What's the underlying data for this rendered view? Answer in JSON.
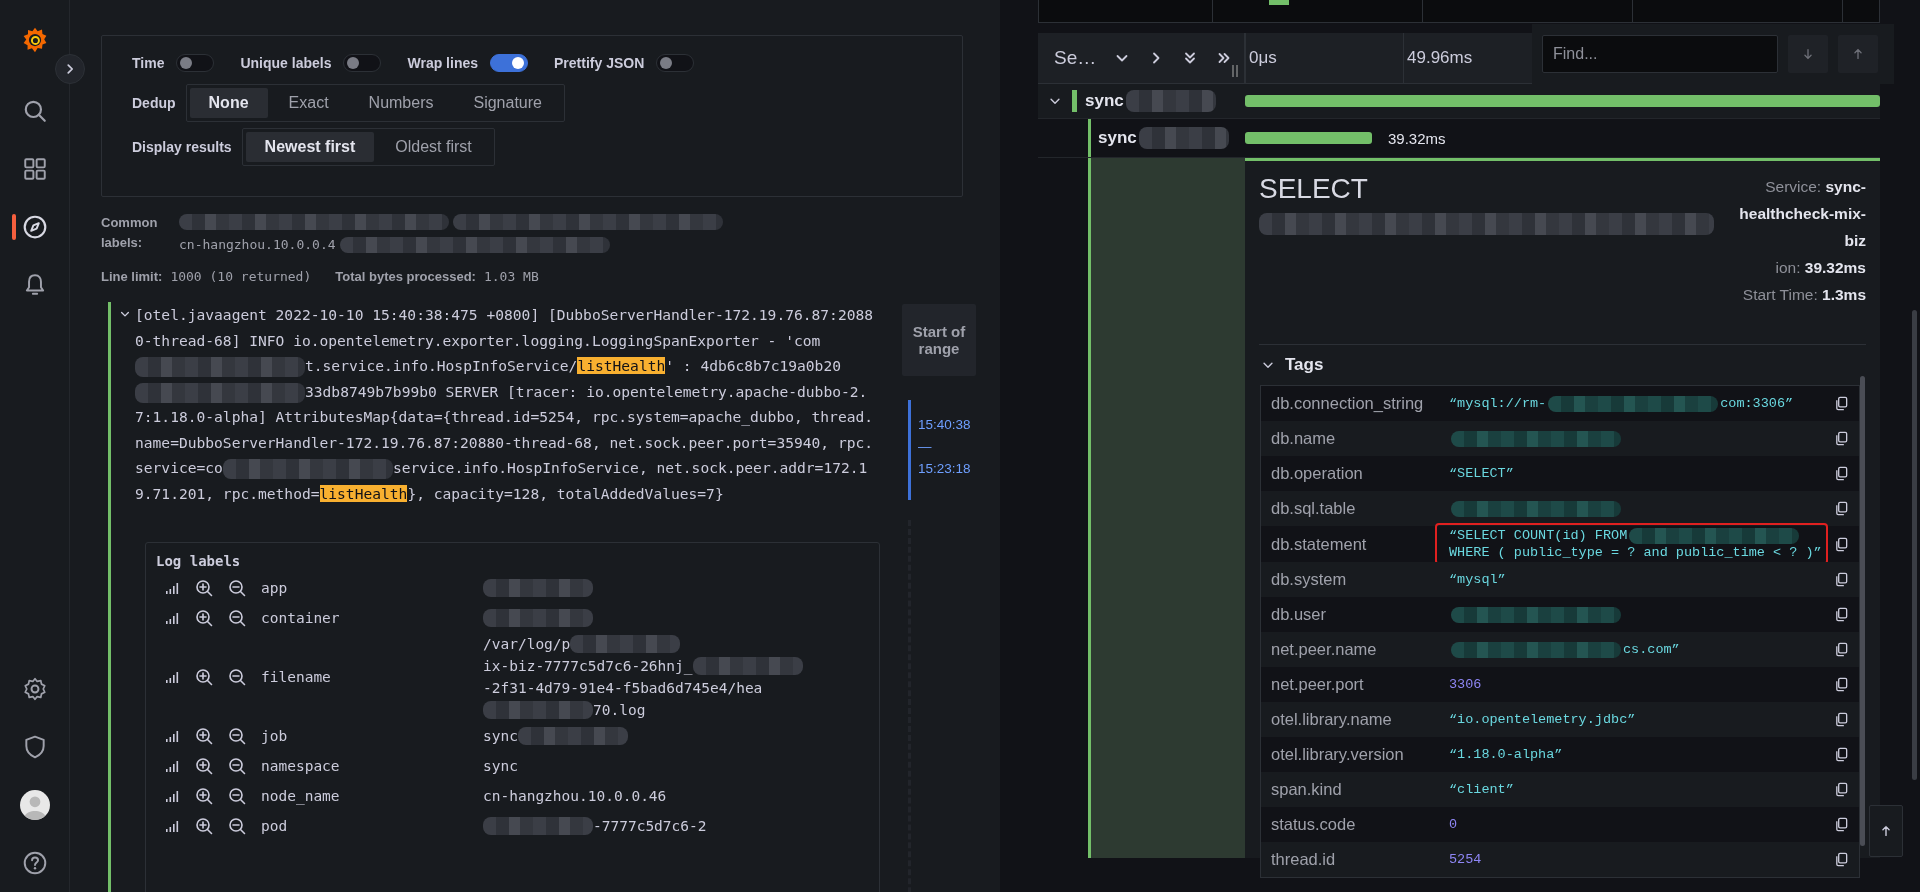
{
  "nav": {
    "top": [
      {
        "kind": "search",
        "selected": false
      },
      {
        "kind": "dashboards",
        "selected": false
      },
      {
        "kind": "explore",
        "selected": true
      },
      {
        "kind": "alerting",
        "selected": false
      }
    ],
    "bottom": [
      {
        "kind": "settings"
      },
      {
        "kind": "shield"
      },
      {
        "kind": "avatar"
      },
      {
        "kind": "help"
      }
    ]
  },
  "options": {
    "toggles": [
      {
        "label": "Time",
        "on": false
      },
      {
        "label": "Unique labels",
        "on": false
      },
      {
        "label": "Wrap lines",
        "on": true
      },
      {
        "label": "Prettify JSON",
        "on": false
      }
    ],
    "dedup": {
      "label": "Dedup",
      "options": [
        {
          "label": "None",
          "selected": true
        },
        {
          "label": "Exact",
          "selected": false
        },
        {
          "label": "Numbers",
          "selected": false
        },
        {
          "label": "Signature",
          "selected": false
        }
      ]
    },
    "display": {
      "label": "Display results",
      "options": [
        {
          "label": "Newest first",
          "selected": true
        },
        {
          "label": "Oldest first",
          "selected": false
        }
      ]
    }
  },
  "common_labels": {
    "label": "Common labels:",
    "value": [
      {
        "kind": "blur"
      },
      {
        "kind": "blur"
      },
      {
        "kind": "text",
        "text": "cn-hangzhou.10.0.0.4"
      },
      {
        "kind": "blur"
      }
    ]
  },
  "stats": [
    {
      "label": "Line limit:",
      "value": "1000 (10 returned)"
    },
    {
      "label": "Total bytes processed:",
      "value": "1.03 MB"
    }
  ],
  "log_row": {
    "expanded": true,
    "start_of_range": "Start of range",
    "range": "15:40:38 — 15:23:18",
    "message": [
      {
        "kind": "text",
        "text": "[otel.javaagent 2022-10-10 15:40:38:475 +0800] [DubboServerHandler-172.19.76.87:20880-thread-68] INFO io.opentelemetry.exporter.logging.LoggingSpanExporter - 'com"
      },
      {
        "kind": "blur"
      },
      {
        "kind": "text",
        "text": "t.service.info.HospInfoService/"
      },
      {
        "kind": "mark",
        "text": "listHealth"
      },
      {
        "kind": "text",
        "text": "' : 4db6c8b7c19a0b20"
      },
      {
        "kind": "blur"
      },
      {
        "kind": "text",
        "text": "33db8749b7b99b0 SERVER [tracer: io.opentelemetry.apache-dubbo-2.7:1.18.0-alpha] AttributesMap{data={thread.id=5254, rpc.system=apache_dubbo, thread.name=DubboServerHandler-172.19.76.87:20880-thread-68, net.sock.peer.port=35940, rpc.service=co"
      },
      {
        "kind": "blur"
      },
      {
        "kind": "text",
        "text": "service.info.HospInfoService, net.sock.peer.addr=172.19.71.201, rpc.method="
      },
      {
        "kind": "mark",
        "text": "listHealth"
      },
      {
        "kind": "text",
        "text": "}, capacity=128, totalAddedValues=7}"
      }
    ]
  },
  "log_labels": {
    "title": "Log labels",
    "rows": [
      {
        "name": "app",
        "value": [
          {
            "kind": "blur"
          }
        ]
      },
      {
        "name": "container",
        "value": [
          {
            "kind": "blur"
          }
        ]
      },
      {
        "name": "filename",
        "value": [
          {
            "kind": "text",
            "text": "/var/log/p"
          },
          {
            "kind": "blur"
          },
          {
            "kind": "text",
            "text": "ix-biz-7777c5d7c6-26hnj_"
          },
          {
            "kind": "blur"
          },
          {
            "kind": "text",
            "text": "-2f31-4d79-91e4-f5bad6d745e4/hea"
          },
          {
            "kind": "blur"
          },
          {
            "kind": "text",
            "text": "70.log"
          }
        ]
      },
      {
        "name": "job",
        "value": [
          {
            "kind": "text",
            "text": "sync"
          },
          {
            "kind": "blur"
          }
        ]
      },
      {
        "name": "namespace",
        "value": [
          {
            "kind": "text",
            "text": "sync"
          }
        ]
      },
      {
        "name": "node_name",
        "value": [
          {
            "kind": "text",
            "text": "cn-hangzhou.10.0.0.46"
          }
        ]
      },
      {
        "name": "pod",
        "value": [
          {
            "kind": "blur"
          },
          {
            "kind": "text",
            "text": "-7777c5d7c6-2"
          }
        ]
      }
    ]
  },
  "trace": {
    "header": {
      "title": "Se…",
      "ticks": [
        "0μs",
        "49.96ms"
      ]
    },
    "find": {
      "placeholder": "Find..."
    },
    "spans": [
      {
        "name": "sync",
        "expanded": true,
        "level": 1,
        "children": [
          {
            "name": "sync",
            "level": 0.2,
            "duration": "39.32ms"
          }
        ]
      }
    ],
    "detail": {
      "title": "SELECT",
      "attributes": [
        {
          "label": "Service:",
          "value": "sync-healthcheck-mix-biz"
        },
        {
          "label": "ion:",
          "value": "39.32ms"
        },
        {
          "label": "Start Time:",
          "value": "1.3ms"
        }
      ]
    },
    "tags": {
      "title": "Tags",
      "expanded": true,
      "rows": [
        {
          "key": "db.connection_string",
          "kind": "string",
          "outlined": false,
          "value": [
            {
              "kind": "text",
              "text": "“mysql://rm-"
            },
            {
              "kind": "blur"
            },
            {
              "kind": "text",
              "text": "com:3306”"
            }
          ]
        },
        {
          "key": "db.name",
          "kind": "string",
          "outlined": false,
          "value": [
            {
              "kind": "blur"
            }
          ]
        },
        {
          "key": "db.operation",
          "kind": "string",
          "outlined": false,
          "value": [
            {
              "kind": "text",
              "text": "“SELECT”"
            }
          ]
        },
        {
          "key": "db.sql.table",
          "kind": "string",
          "outlined": false,
          "value": [
            {
              "kind": "blur"
            }
          ]
        },
        {
          "key": "db.statement",
          "kind": "string",
          "outlined": true,
          "value": [
            {
              "kind": "text",
              "text": "“SELECT COUNT(id) FROM"
            },
            {
              "kind": "blur"
            },
            {
              "kind": "text",
              "text": "WHERE ( public_type = ? and public_time < ? )”"
            }
          ]
        },
        {
          "key": "db.system",
          "kind": "string",
          "outlined": false,
          "value": [
            {
              "kind": "text",
              "text": "“mysql”"
            }
          ]
        },
        {
          "key": "db.user",
          "kind": "string",
          "outlined": false,
          "value": [
            {
              "kind": "blur"
            }
          ]
        },
        {
          "key": "net.peer.name",
          "kind": "string",
          "outlined": false,
          "value": [
            {
              "kind": "blur"
            },
            {
              "kind": "text",
              "text": "cs.com”"
            }
          ]
        },
        {
          "key": "net.peer.port",
          "kind": "number",
          "outlined": false,
          "value": [
            {
              "kind": "text",
              "text": "3306"
            }
          ]
        },
        {
          "key": "otel.library.name",
          "kind": "string",
          "outlined": false,
          "value": [
            {
              "kind": "text",
              "text": "“io.opentelemetry.jdbc”"
            }
          ]
        },
        {
          "key": "otel.library.version",
          "kind": "string",
          "outlined": false,
          "value": [
            {
              "kind": "text",
              "text": "“1.18.0-alpha”"
            }
          ]
        },
        {
          "key": "span.kind",
          "kind": "string",
          "outlined": false,
          "value": [
            {
              "kind": "text",
              "text": "“client”"
            }
          ]
        },
        {
          "key": "status.code",
          "kind": "number",
          "outlined": false,
          "value": [
            {
              "kind": "text",
              "text": "0"
            }
          ]
        },
        {
          "key": "thread.id",
          "kind": "number",
          "outlined": false,
          "value": [
            {
              "kind": "text",
              "text": "5254"
            }
          ]
        }
      ]
    }
  }
}
